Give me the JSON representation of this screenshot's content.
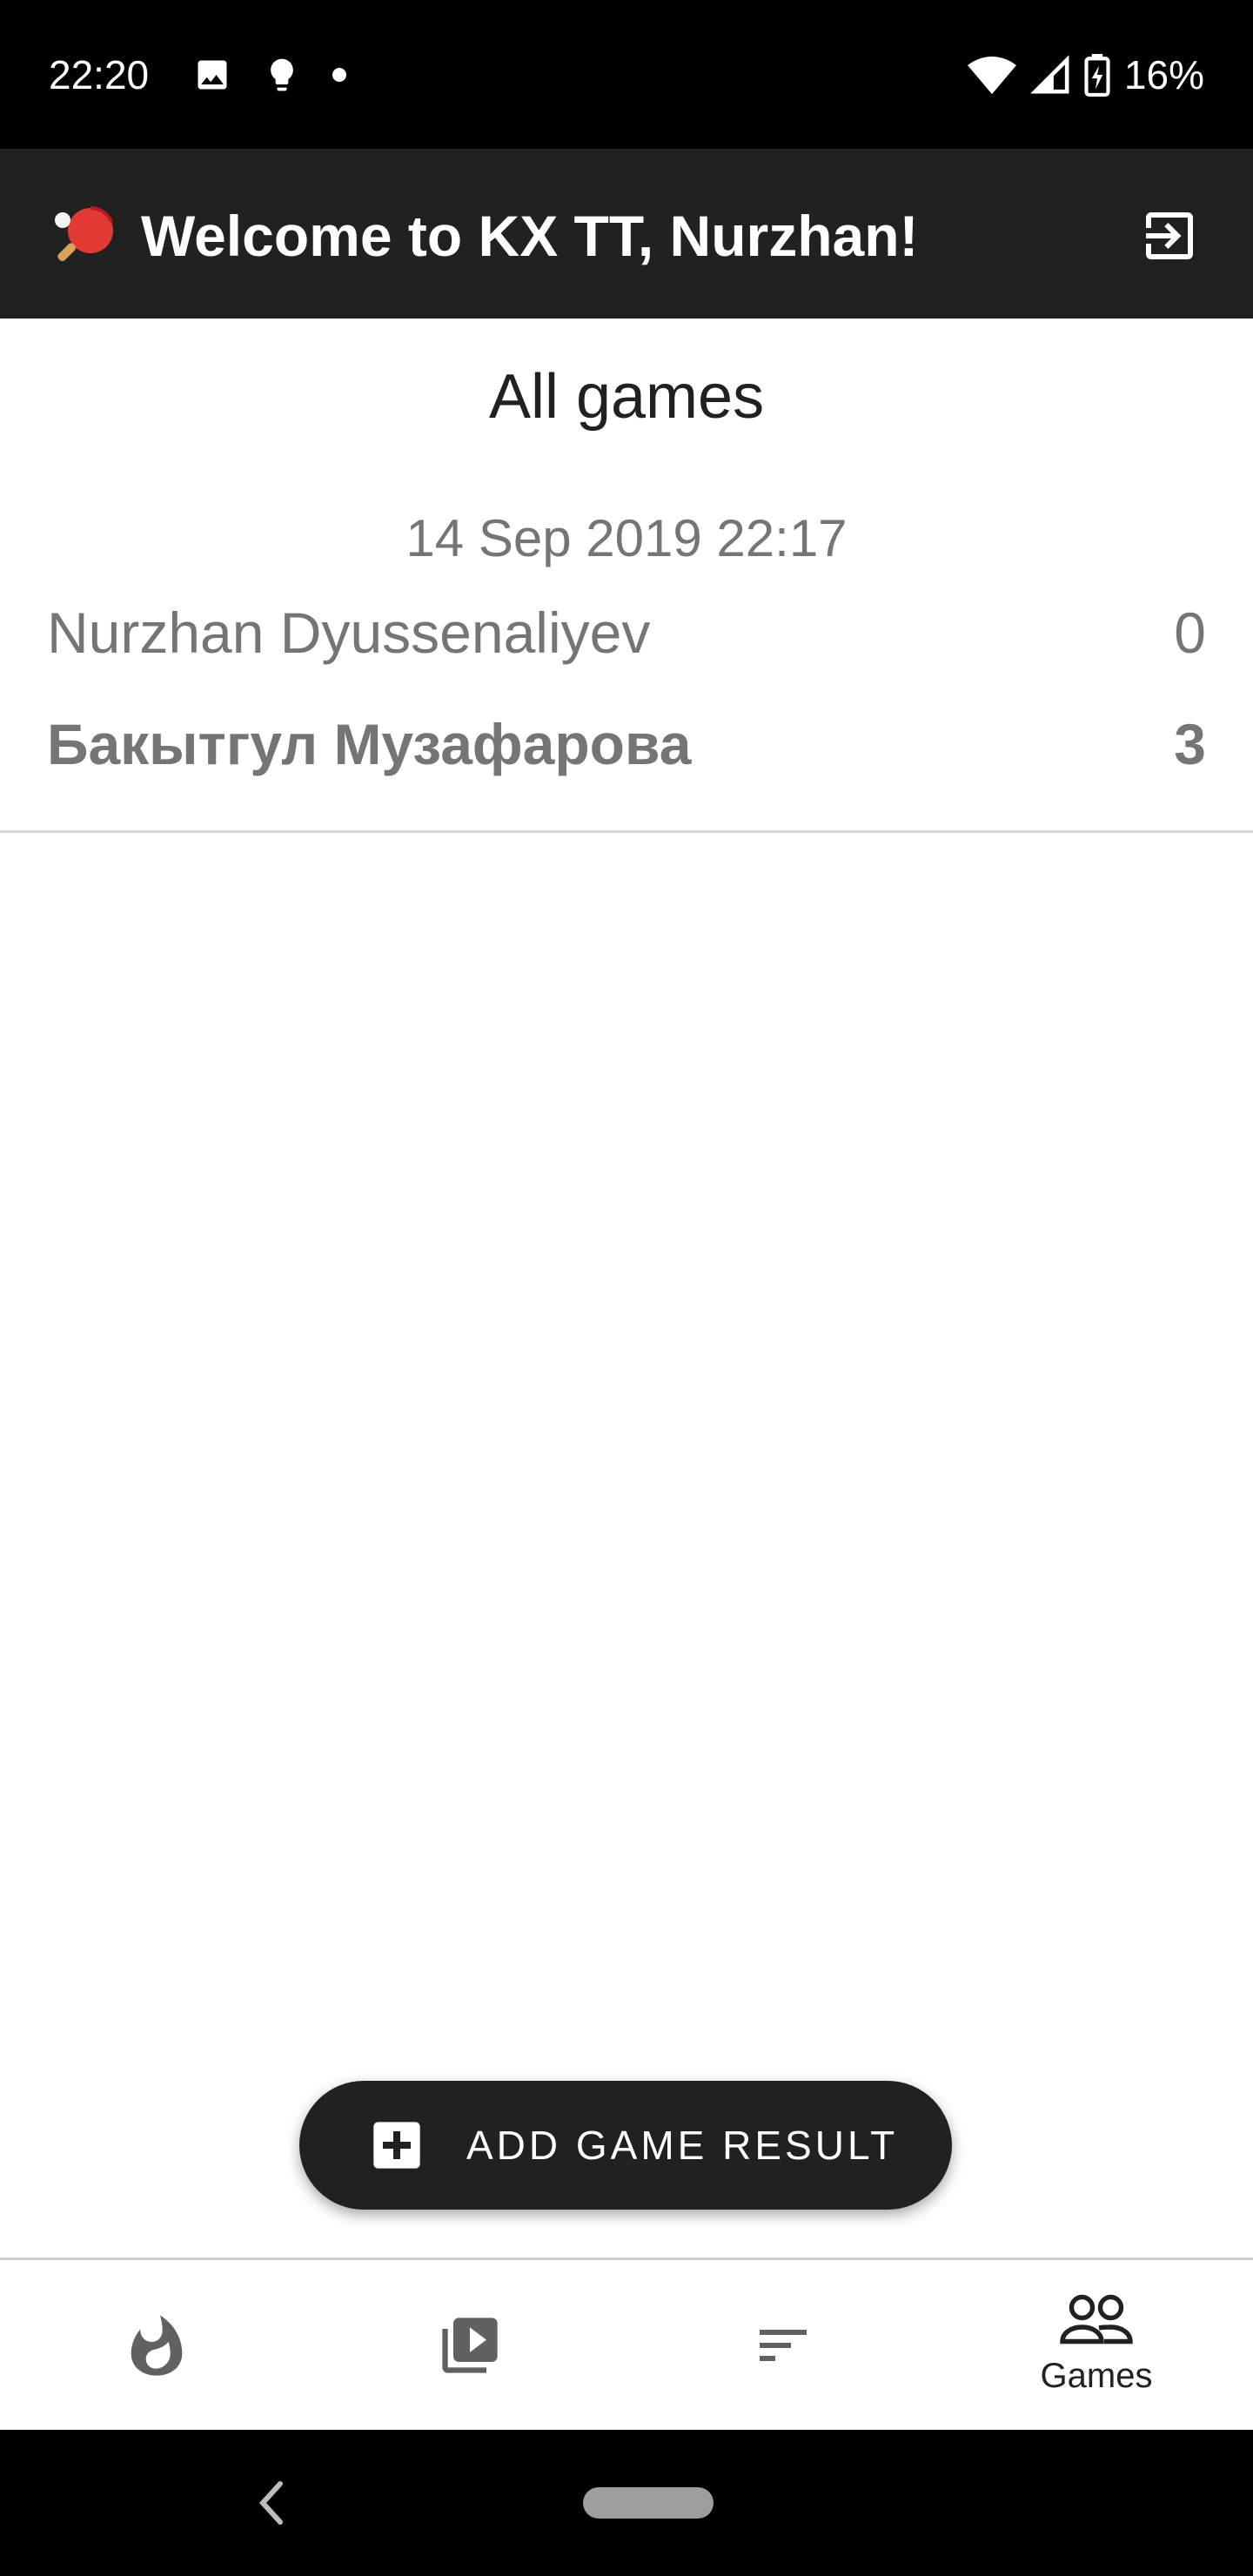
{
  "status_bar": {
    "time": "22:20",
    "battery_percent": "16%",
    "left_icons": [
      "image-icon",
      "lightbulb-icon",
      "dot-icon"
    ],
    "right_icons": [
      "wifi-icon",
      "signal-icon",
      "battery-charging-icon"
    ]
  },
  "app_bar": {
    "logo_icon": "ping-pong-icon",
    "title": "Welcome to KX TT, Nurzhan!",
    "logout_icon": "logout-icon"
  },
  "main": {
    "page_title": "All games",
    "games": [
      {
        "date": "14 Sep 2019 22:17",
        "players": [
          {
            "name": "Nurzhan Dyussenaliyev",
            "score": "0"
          },
          {
            "name": "Бакытгул Музафарова",
            "score": "3"
          }
        ]
      }
    ]
  },
  "fab": {
    "label": "ADD GAME RESULT",
    "icon": "add-box-icon"
  },
  "bottom_nav": {
    "items": [
      {
        "icon": "flame-icon",
        "label": ""
      },
      {
        "icon": "video-library-icon",
        "label": ""
      },
      {
        "icon": "sort-icon",
        "label": ""
      },
      {
        "icon": "people-icon",
        "label": "Games"
      }
    ],
    "active_index": 3
  },
  "colors": {
    "app_bar": "#212121",
    "status_bar": "#000000",
    "text_secondary": "#757575",
    "fab": "#212121"
  }
}
